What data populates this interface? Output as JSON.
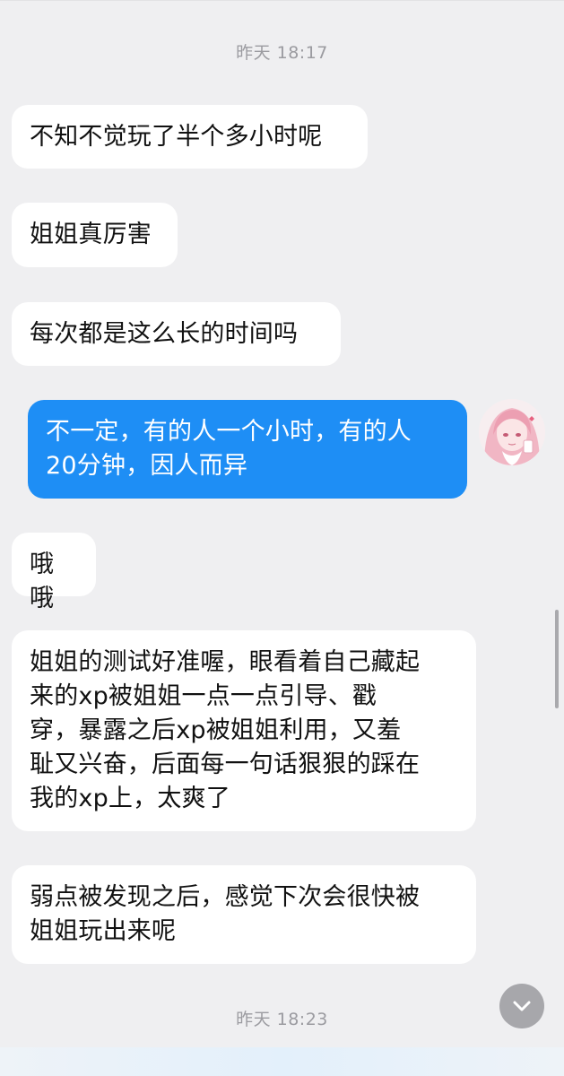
{
  "timestamps": [
    "昨天 18:17",
    "昨天 18:23"
  ],
  "messages": [
    {
      "side": "in",
      "text": "不知不觉玩了半个多小时呢"
    },
    {
      "side": "in",
      "text": "姐姐真厉害"
    },
    {
      "side": "in",
      "text": "每次都是这么长的时间吗"
    },
    {
      "side": "out",
      "text": "不一定，有的人一个小时，有的人\n20分钟，因人而异"
    },
    {
      "side": "in",
      "text": "哦哦"
    },
    {
      "side": "in",
      "text": "姐姐的测试好准喔，眼看着自己藏起\n来的xp被姐姐一点一点引导、戳\n穿，暴露之后xp被姐姐利用，又羞\n耻又兴奋，后面每一句话狠狠的踩在\n我的xp上，太爽了"
    },
    {
      "side": "in",
      "text": "弱点被发现之后，感觉下次会很快被\n姐姐玩出来呢"
    }
  ],
  "colors": {
    "background": "#efeff1",
    "incoming_bubble": "#ffffff",
    "outgoing_bubble": "#1e8ef5",
    "timestamp_text": "#9b9ba0"
  },
  "icons": {
    "scroll_to_bottom": "chevron-down-icon",
    "avatar": "avatar-anime-girl"
  }
}
